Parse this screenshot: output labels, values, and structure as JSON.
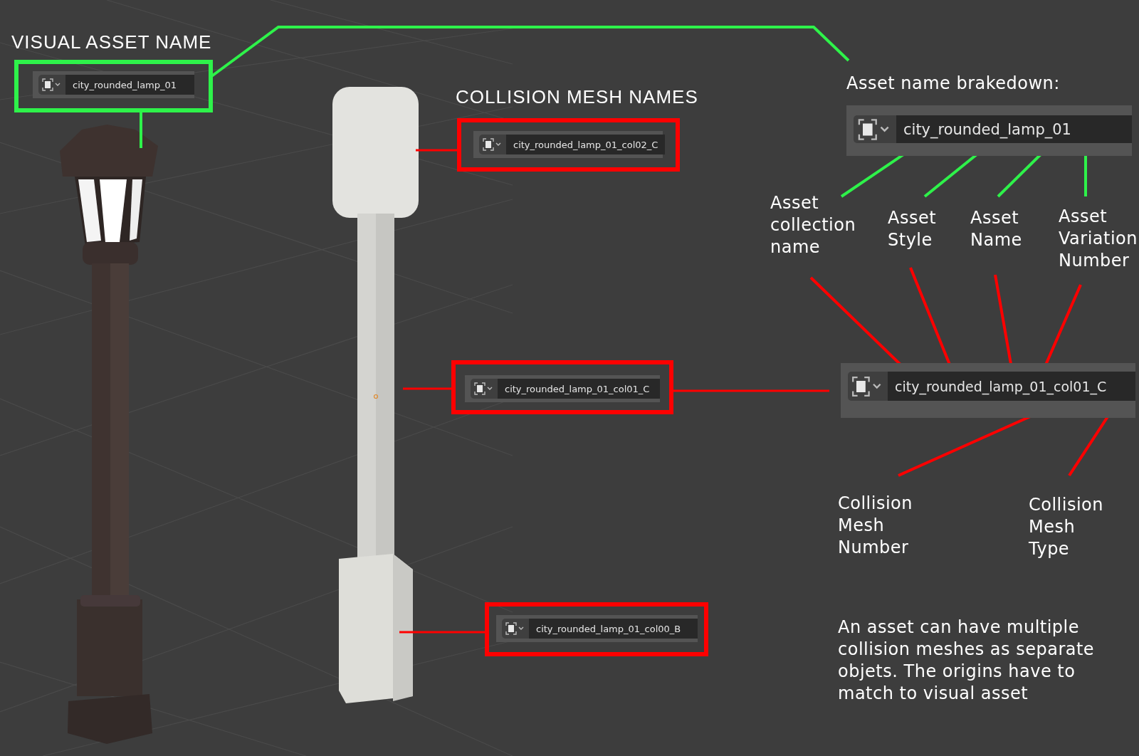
{
  "visual_asset": {
    "heading": "VISUAL ASSET NAME",
    "object_name": "city_rounded_lamp_01"
  },
  "collision_meshes": {
    "heading": "COLLISION MESH NAMES",
    "fields": [
      {
        "object_name": "city_rounded_lamp_01_col02_C"
      },
      {
        "object_name": "city_rounded_lamp_01_col01_C"
      },
      {
        "object_name": "city_rounded_lamp_01_col00_B"
      }
    ]
  },
  "breakdown": {
    "heading": "Asset name brakedown:",
    "object_name": "city_rounded_lamp_01",
    "parts": [
      {
        "label": "Asset collection name"
      },
      {
        "label": "Asset Style"
      },
      {
        "label": "Asset Name"
      },
      {
        "label": "Asset Variation Number"
      }
    ],
    "collision_object_name": "city_rounded_lamp_01_col01_C",
    "collision_parts": [
      {
        "label": "Collision Mesh Number"
      },
      {
        "label": "Collision Mesh Type"
      }
    ],
    "note": "An asset can have multiple collision meshes as separate objets. The origins have to match to visual asset"
  }
}
